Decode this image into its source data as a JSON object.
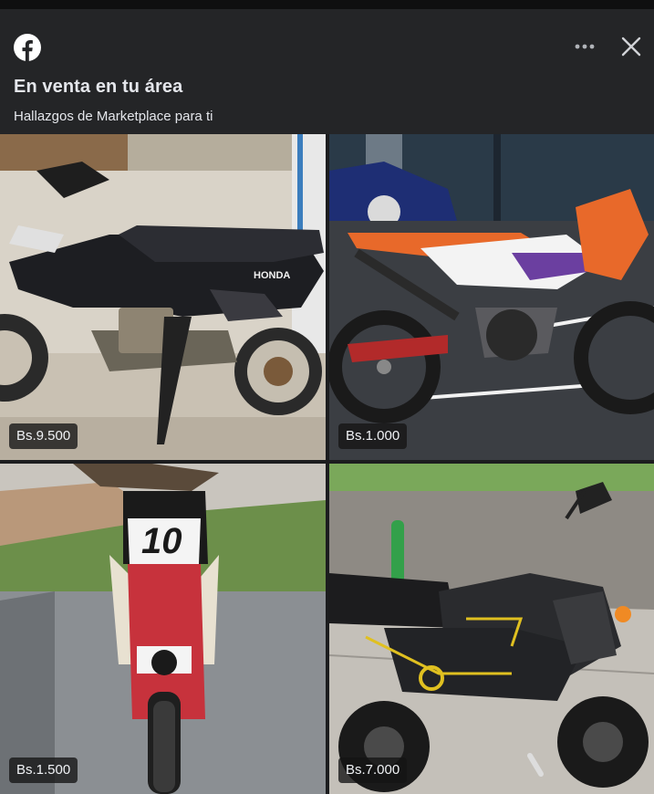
{
  "header": {
    "title": "En venta en tu área",
    "subtitle": "Hallazgos de Marketplace para ti",
    "logo_icon": "facebook-icon",
    "more_icon": "more-dots-icon",
    "close_icon": "close-icon"
  },
  "listings": [
    {
      "price": "Bs.9.500",
      "brand": "HONDA"
    },
    {
      "price": "Bs.1.000"
    },
    {
      "price": "Bs.1.500",
      "number": "10"
    },
    {
      "price": "Bs.7.000"
    }
  ],
  "colors": {
    "background": "#1c1d1f",
    "header": "#242527",
    "text": "#e4e6eb"
  }
}
